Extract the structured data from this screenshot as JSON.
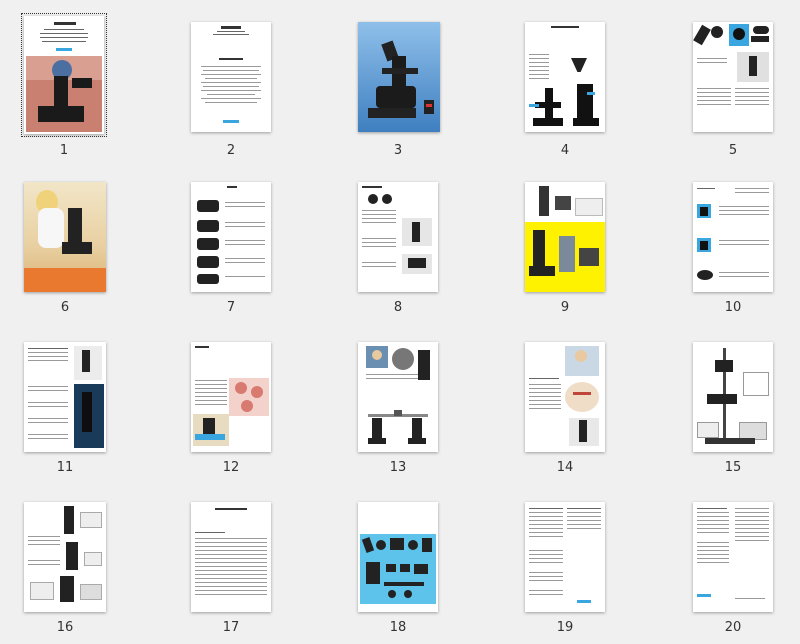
{
  "pages": [
    {
      "number": "1",
      "selected": true
    },
    {
      "number": "2"
    },
    {
      "number": "3"
    },
    {
      "number": "4"
    },
    {
      "number": "5"
    },
    {
      "number": "6"
    },
    {
      "number": "7"
    },
    {
      "number": "8"
    },
    {
      "number": "9"
    },
    {
      "number": "10"
    },
    {
      "number": "11"
    },
    {
      "number": "12"
    },
    {
      "number": "13"
    },
    {
      "number": "14"
    },
    {
      "number": "15"
    },
    {
      "number": "16"
    },
    {
      "number": "17"
    },
    {
      "number": "18"
    },
    {
      "number": "19"
    },
    {
      "number": "20"
    }
  ],
  "colors": {
    "background": "#f0f0f0",
    "thumb_paper": "#ffffff",
    "label_text": "#333333",
    "selection_outline": "#333333",
    "accent_blue": "#3aa6e0",
    "accent_yellow": "#fff200",
    "accent_cyan": "#5ec3ea",
    "accent_pink": "#e9b7b0"
  }
}
